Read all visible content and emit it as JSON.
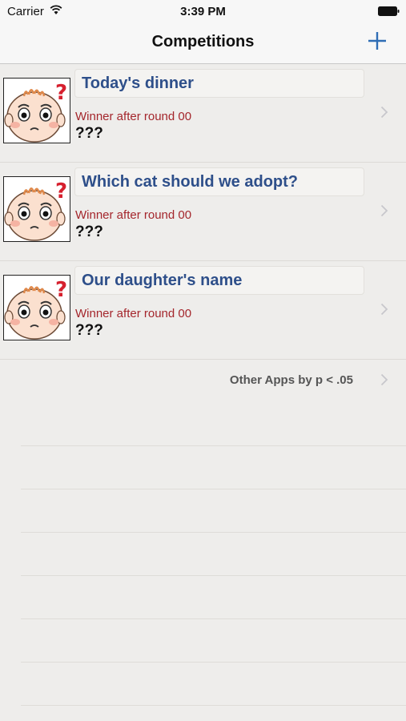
{
  "status_bar": {
    "carrier": "Carrier",
    "time": "3:39 PM"
  },
  "nav": {
    "title": "Competitions"
  },
  "competitions": [
    {
      "title": "Today's dinner",
      "subtitle": "Winner after round 00",
      "winner": "???"
    },
    {
      "title": "Which cat should we adopt?",
      "subtitle": "Winner after round 00",
      "winner": "???"
    },
    {
      "title": "Our daughter's name",
      "subtitle": "Winner after round 00",
      "winner": "???"
    }
  ],
  "other_apps": {
    "label": "Other Apps by p < .05"
  },
  "colors": {
    "title_blue": "#2e4f8a",
    "subtitle_red": "#a4262c",
    "accent_blue": "#2f6db5"
  }
}
